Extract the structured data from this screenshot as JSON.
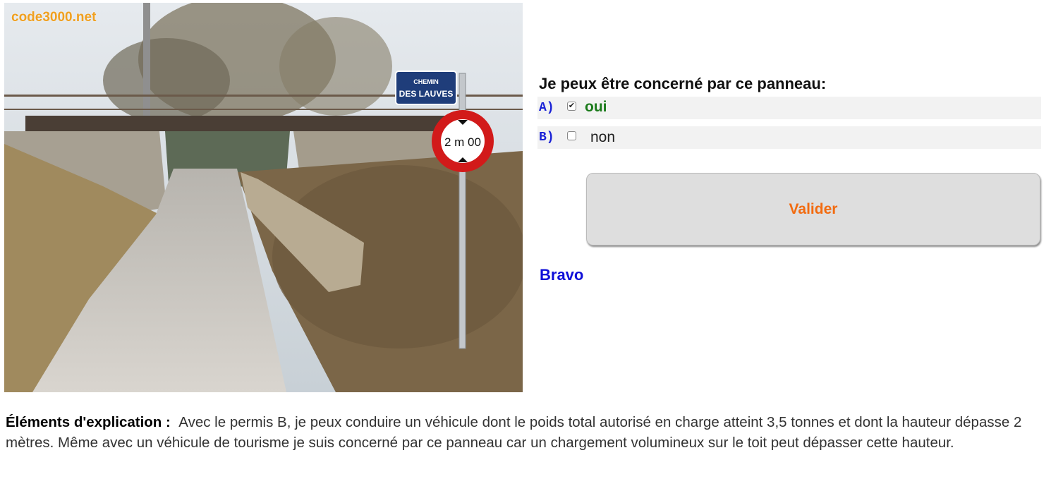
{
  "photo": {
    "watermark": "code3000.net",
    "street_sign_line1": "CHEMIN",
    "street_sign_line2": "DES LAUVES",
    "height_sign_text": "2 m 00"
  },
  "question": {
    "prompt": "Je peux être concerné par ce panneau:",
    "answers": [
      {
        "letter": "A)",
        "label": "oui",
        "checked": true
      },
      {
        "letter": "B)",
        "label": "non",
        "checked": false
      }
    ],
    "check_glyph": "✔",
    "submit_label": "Valider",
    "result": "Bravo"
  },
  "explanation": {
    "label": "Éléments d'explication :",
    "text": "Avec le permis B, je peux conduire un véhicule dont le poids total autorisé en charge atteint 3,5 tonnes et dont la hauteur dépasse 2 mètres. Même avec un véhicule de tourisme je suis concerné par ce panneau car un chargement volumineux sur le toit peut dépasser cette hauteur."
  },
  "colors": {
    "letter": "#1a22d6",
    "answer_correct": "#1a7a1a",
    "submit_text": "#f26b10",
    "result": "#1010d8",
    "sign_red": "#d21a1a"
  }
}
